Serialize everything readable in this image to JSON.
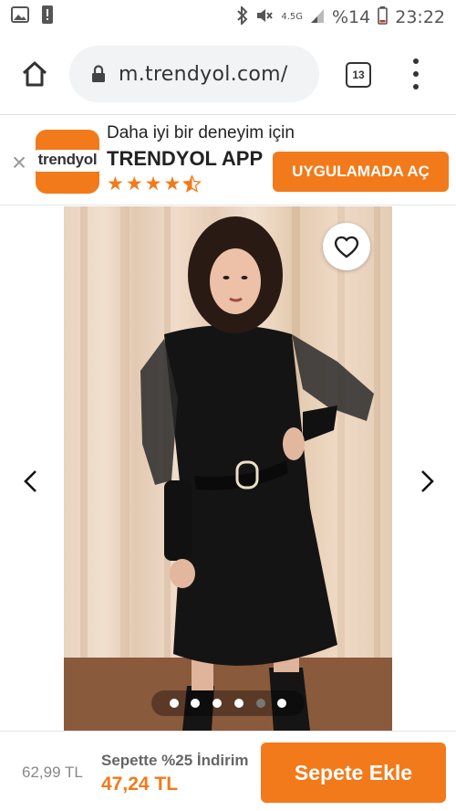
{
  "status_bar": {
    "network_label": "4.5G",
    "battery_percent": "%14",
    "time": "23:22"
  },
  "browser": {
    "url": "m.trendyol.com/",
    "tab_count": "13"
  },
  "app_banner": {
    "subtitle": "Daha iyi bir deneyim için",
    "title": "TRENDYOL APP",
    "logo_text": "trendyol",
    "rating_stars": 4.5,
    "open_button": "UYGULAMADA AÇ"
  },
  "gallery": {
    "image_count": 6,
    "active_index": 4
  },
  "purchase": {
    "old_price": "62,99 TL",
    "cart_discount": "Sepette %25 İndirim",
    "new_price": "47,24 TL",
    "add_to_cart": "Sepete Ekle"
  },
  "colors": {
    "accent": "#f27a1a"
  }
}
